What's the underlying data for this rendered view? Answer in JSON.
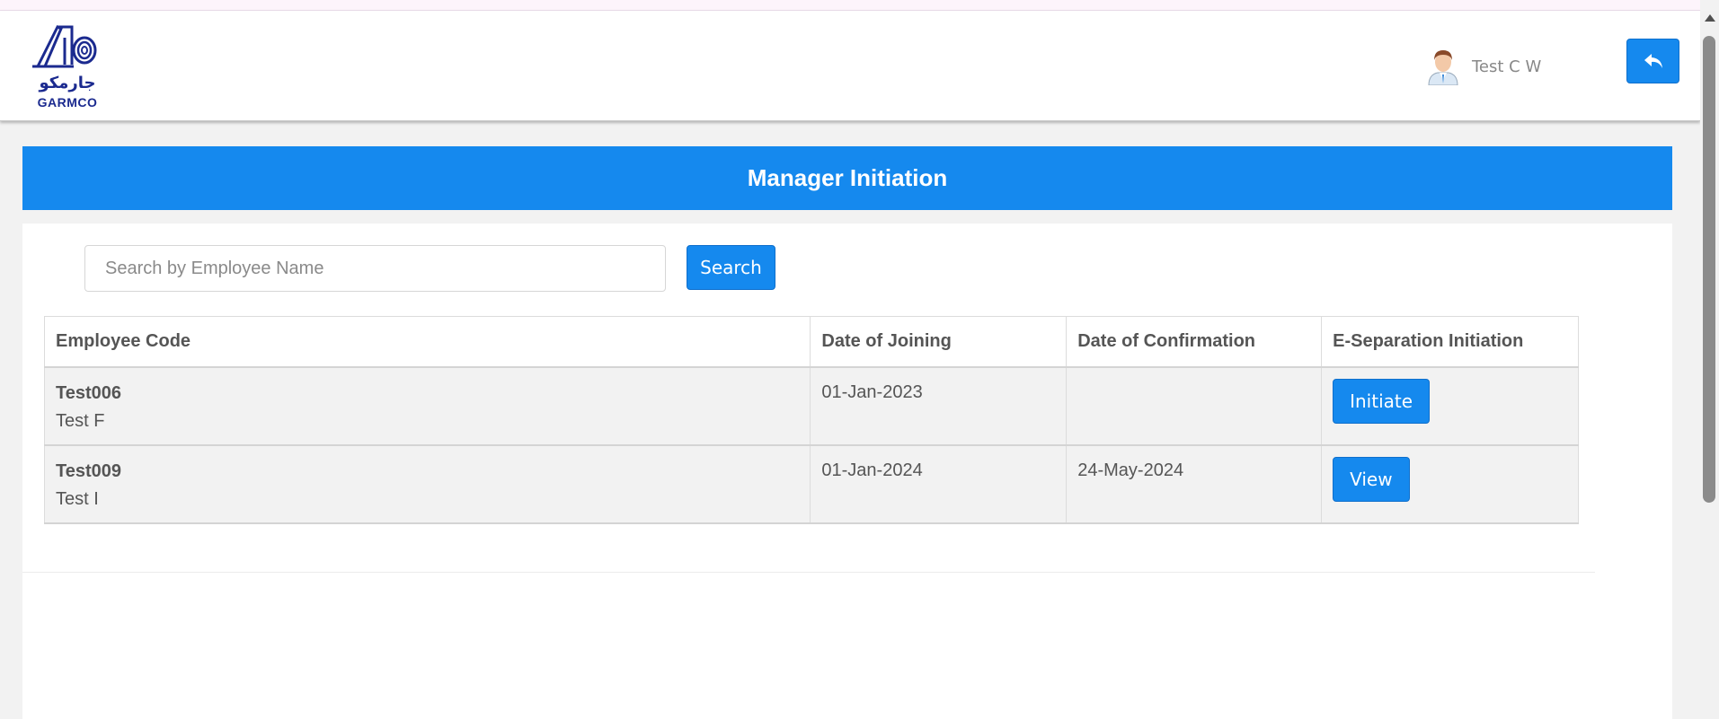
{
  "header": {
    "logo_ar": "جارمكو",
    "logo_en": "GARMCO",
    "user_name": "Test C W",
    "back_icon": "reply-arrow-icon"
  },
  "page": {
    "title": "Manager Initiation"
  },
  "search": {
    "placeholder": "Search by Employee Name",
    "value": "",
    "button_label": "Search"
  },
  "table": {
    "headers": [
      "Employee Code",
      "Date of Joining",
      "Date of Confirmation",
      "E-Separation Initiation"
    ],
    "rows": [
      {
        "code": "Test006",
        "name": "Test F",
        "date_joining": "01-Jan-2023",
        "date_confirmation": "",
        "action": "Initiate"
      },
      {
        "code": "Test009",
        "name": "Test I",
        "date_joining": "01-Jan-2024",
        "date_confirmation": "24-May-2024",
        "action": "View"
      }
    ]
  },
  "colors": {
    "primary": "#1589ee",
    "logo": "#1b2a8f",
    "text": "#555555"
  }
}
